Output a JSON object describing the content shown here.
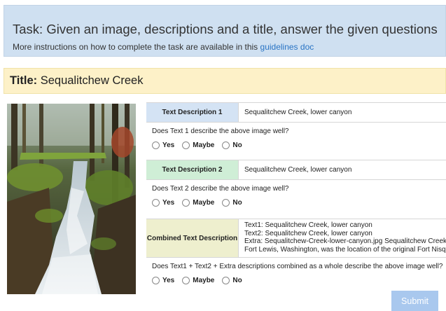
{
  "task": {
    "title": "Task: Given an image, descriptions and a title, answer the given questions",
    "instructions_prefix": "More instructions on how to complete the task are available in this ",
    "instructions_link": "guidelines doc"
  },
  "title_bar": {
    "label": "Title:",
    "value": "Sequalitchew Creek"
  },
  "sections": [
    {
      "label": "Text Description 1",
      "label_bg": "#d4e3f4",
      "value_lines": [
        "Sequalitchew Creek, lower canyon"
      ],
      "question": "Does Text 1 describe the above image well?",
      "options": [
        "Yes",
        "Maybe",
        "No"
      ]
    },
    {
      "label": "Text Description 2",
      "label_bg": "#cfeed6",
      "value_lines": [
        "Sequalitchew Creek, lower canyon"
      ],
      "question": "Does Text 2 describe the above image well?",
      "options": [
        "Yes",
        "Maybe",
        "No"
      ]
    },
    {
      "label": "Combined Text Description",
      "label_bg": "#eeefce",
      "value_lines": [
        "Text1: Sequalitchew Creek, lower canyon",
        "Text2: Sequalitchew Creek, lower canyon",
        "Extra: Sequalitchew-Creek-lower-canyon.jpg Sequalitchew Creek, located i",
        "Fort Lewis, Washington, was the location of the original Fort Nisqually tradi"
      ],
      "question": "Does Text1 + Text2 + Extra descriptions combined as a whole describe the above image well?",
      "options": [
        "Yes",
        "Maybe",
        "No"
      ]
    }
  ],
  "submit_label": "Submit"
}
